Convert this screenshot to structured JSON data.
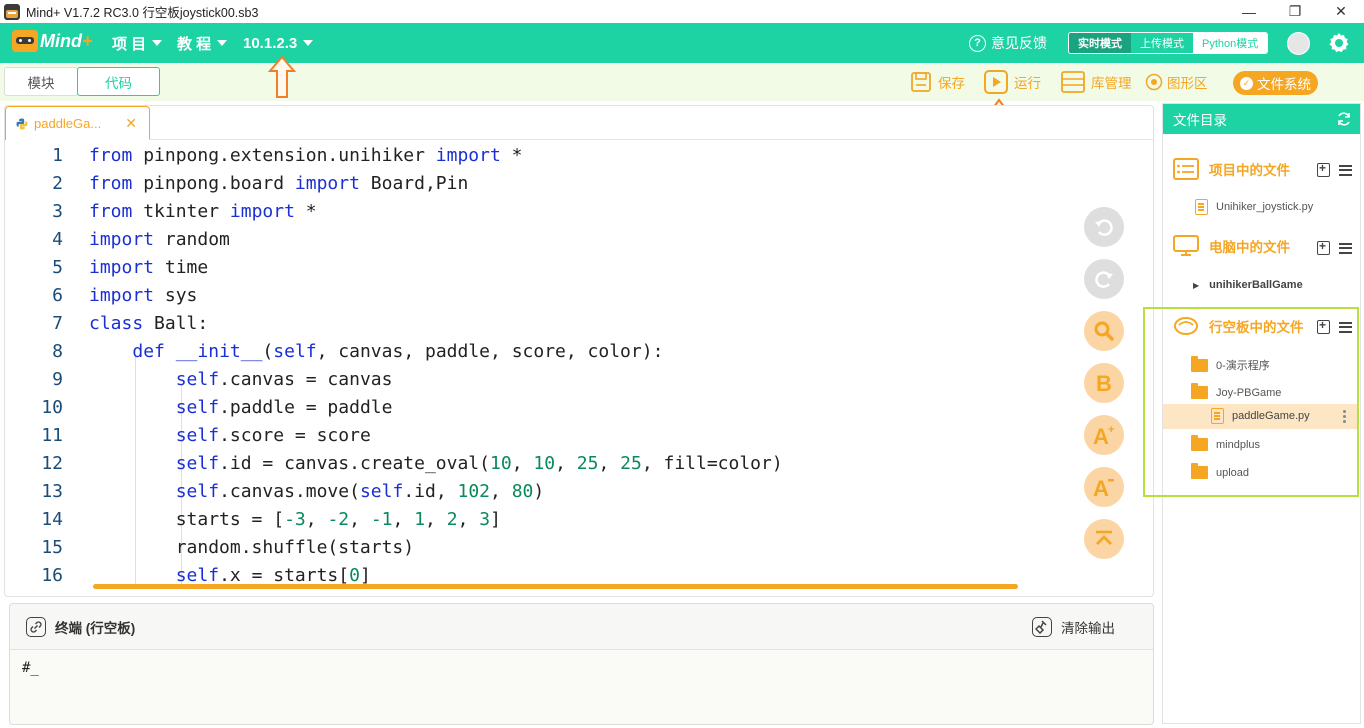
{
  "window": {
    "title": "Mind+ V1.7.2 RC3.0   行空板joystick00.sb3",
    "buttons": [
      "—",
      "❐",
      "✕"
    ]
  },
  "topbar": {
    "logo_text_a": "Mind",
    "logo_text_b": "+",
    "menu_project": "项 目",
    "menu_tutorial": "教 程",
    "menu_ip": "10.1.2.3",
    "feedback": "意见反馈",
    "mode_realtime": "实时模式",
    "mode_upload": "上传模式",
    "mode_python": "Python模式"
  },
  "subbar": {
    "tab_blocks": "模块",
    "tab_code": "代码",
    "save": "保存",
    "run": "运行",
    "library": "库管理",
    "graphics": "图形区",
    "filesystem": "文件系统"
  },
  "editor": {
    "file_tab": "paddleGa...",
    "lines": [
      {
        "n": "1"
      },
      {
        "n": "2"
      },
      {
        "n": "3"
      },
      {
        "n": "4"
      },
      {
        "n": "5"
      },
      {
        "n": "6"
      },
      {
        "n": "7"
      },
      {
        "n": "8"
      },
      {
        "n": "9"
      },
      {
        "n": "10"
      },
      {
        "n": "11"
      },
      {
        "n": "12"
      },
      {
        "n": "13"
      },
      {
        "n": "14"
      },
      {
        "n": "15"
      },
      {
        "n": "16"
      }
    ],
    "code": [
      "from pinpong.extension.unihiker import *",
      "from pinpong.board import Board,Pin",
      "from tkinter import *",
      "import random",
      "import time",
      "import sys",
      "class Ball:",
      "    def __init__(self, canvas, paddle, score, color):",
      "        self.canvas = canvas",
      "        self.paddle = paddle",
      "        self.score = score",
      "        self.id = canvas.create_oval(10, 10, 25, 25, fill=color)",
      "        self.canvas.move(self.id, 102, 80)",
      "        starts = [-3, -2, -1, 1, 2, 3]",
      "        random.shuffle(starts)",
      "        self.x = starts[0]"
    ]
  },
  "terminal": {
    "title": "终端 (行空板)",
    "clear": "清除输出",
    "prompt": "#_"
  },
  "file_panel": {
    "title": "文件目录",
    "section_project": "项目中的文件",
    "project_files": [
      "Unihiker_joystick.py"
    ],
    "section_computer": "电脑中的文件",
    "computer_folders": [
      "unihikerBallGame"
    ],
    "section_board": "行空板中的文件",
    "board_items": [
      "0-演示程序",
      "Joy-PBGame",
      "paddleGame.py",
      "mindplus",
      "upload"
    ]
  },
  "colors": {
    "accent": "#1dd3a4",
    "orange": "#f5a623",
    "keyword": "#1a2fd4",
    "number": "#0a8a5a",
    "highlight_box": "#b7e03e"
  }
}
